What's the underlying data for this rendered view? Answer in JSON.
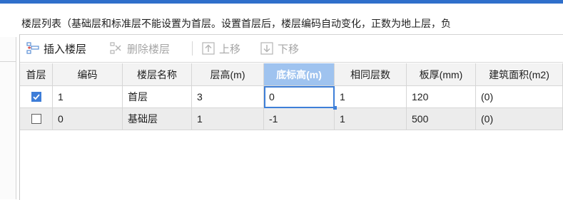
{
  "header": {
    "text": "楼层列表（基础层和标准层不能设置为首层。设置首层后，楼层编码自动变化，正数为地上层，负"
  },
  "toolbar": {
    "insert_label": "插入楼层",
    "delete_label": "删除楼层",
    "up_label": "上移",
    "down_label": "下移"
  },
  "table": {
    "columns": [
      "首层",
      "编码",
      "楼层名称",
      "层高(m)",
      "底标高(m)",
      "相同层数",
      "板厚(mm)",
      "建筑面积(m2)"
    ],
    "rows": [
      {
        "first": true,
        "code": "1",
        "name": "首层",
        "height": "3",
        "base": "0",
        "same": "1",
        "thickness": "120",
        "area": "(0)"
      },
      {
        "first": false,
        "code": "0",
        "name": "基础层",
        "height": "1",
        "base": "-1",
        "same": "1",
        "thickness": "500",
        "area": "(0)"
      }
    ]
  },
  "colors": {
    "accent": "#2f6fcb",
    "selected_header": "#9fc3ef",
    "checkbox_on": "#3d7dd8",
    "row_alt": "#ececec"
  }
}
